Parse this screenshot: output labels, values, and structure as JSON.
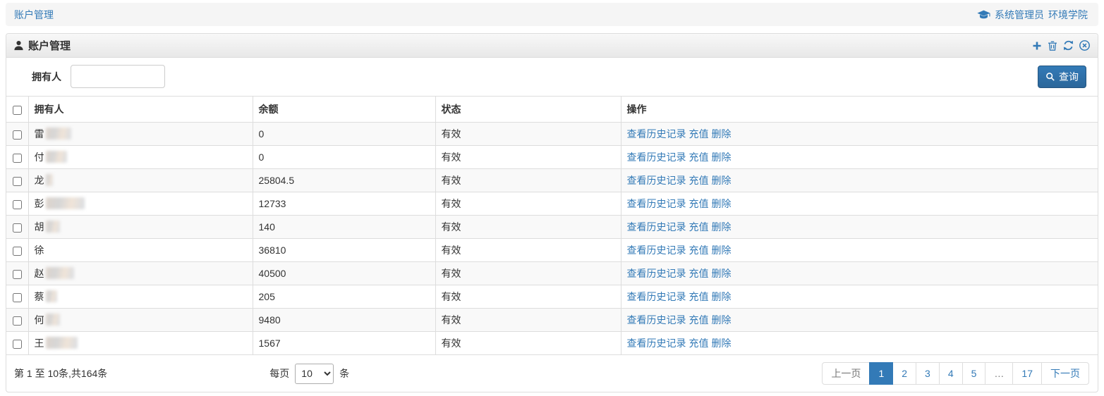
{
  "topbar": {
    "breadcrumb": "账户管理",
    "role": "系统管理员",
    "org": "环境学院",
    "role_icon": "graduation-cap-icon"
  },
  "panel": {
    "title": "账户管理",
    "title_icon": "user-icon",
    "heading_action_icons": [
      "plus-icon",
      "trash-icon",
      "refresh-icon",
      "close-circle-icon"
    ]
  },
  "search": {
    "label": "拥有人",
    "value": "",
    "query_label": "查询",
    "query_icon": "search-icon"
  },
  "table": {
    "headers": [
      "拥有人",
      "余额",
      "状态",
      "操作"
    ],
    "action_links": [
      {
        "label": "查看历史记录",
        "name": "view-history-link"
      },
      {
        "label": "充值",
        "name": "recharge-link"
      },
      {
        "label": "删除",
        "name": "delete-link"
      }
    ],
    "rows": [
      {
        "owner": "雷",
        "masked": true,
        "mask_width": 36,
        "balance": "0",
        "status": "有效"
      },
      {
        "owner": "付",
        "masked": true,
        "mask_width": 30,
        "balance": "0",
        "status": "有效"
      },
      {
        "owner": "龙",
        "masked": true,
        "mask_width": 10,
        "balance": "25804.5",
        "status": "有效"
      },
      {
        "owner": "彭",
        "masked": true,
        "mask_width": 55,
        "balance": "12733",
        "status": "有效"
      },
      {
        "owner": "胡",
        "masked": true,
        "mask_width": 20,
        "balance": "140",
        "status": "有效"
      },
      {
        "owner": "徐",
        "masked": false,
        "mask_width": 0,
        "balance": "36810",
        "status": "有效"
      },
      {
        "owner": "赵",
        "masked": true,
        "mask_width": 40,
        "balance": "40500",
        "status": "有效"
      },
      {
        "owner": "蔡",
        "masked": true,
        "mask_width": 16,
        "balance": "205",
        "status": "有效"
      },
      {
        "owner": "何",
        "masked": true,
        "mask_width": 20,
        "balance": "9480",
        "status": "有效"
      },
      {
        "owner": "王",
        "masked": true,
        "mask_width": 45,
        "balance": "1567",
        "status": "有效"
      }
    ]
  },
  "footer": {
    "range_info": "第 1 至 10条,共164条",
    "per_page_prefix": "每页",
    "per_page_value": "10",
    "per_page_suffix": "条",
    "pagination": [
      {
        "label": "上一页",
        "name": "prev",
        "state": "disabled"
      },
      {
        "label": "1",
        "name": "page-1",
        "state": "active"
      },
      {
        "label": "2",
        "name": "page-2"
      },
      {
        "label": "3",
        "name": "page-3"
      },
      {
        "label": "4",
        "name": "page-4"
      },
      {
        "label": "5",
        "name": "page-5"
      },
      {
        "label": "…",
        "name": "ellipsis",
        "state": "disabled"
      },
      {
        "label": "17",
        "name": "page-17"
      },
      {
        "label": "下一页",
        "name": "next"
      }
    ]
  },
  "colors": {
    "accent": "#337ab7",
    "button_gradient_top": "#337ab7",
    "button_gradient_bottom": "#2b669a",
    "stripe_bg": "#f9f9f9",
    "bar_bg": "#f5f5f5"
  }
}
